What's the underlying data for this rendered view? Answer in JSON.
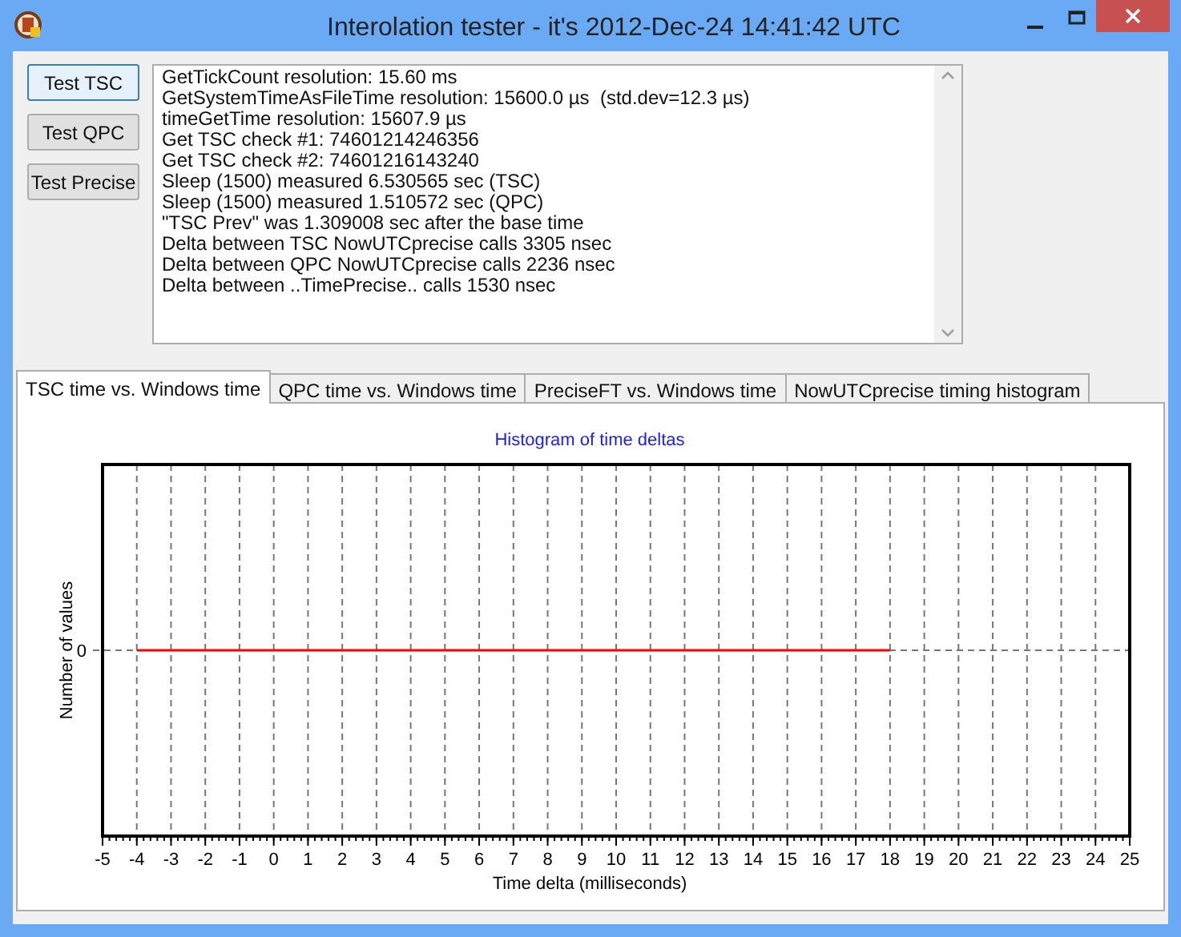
{
  "window": {
    "title": "Interolation tester - it's 2012-Dec-24 14:41:42 UTC"
  },
  "buttons": [
    {
      "label": "Test TSC",
      "selected": true
    },
    {
      "label": "Test QPC",
      "selected": false
    },
    {
      "label": "Test Precise",
      "selected": false
    }
  ],
  "log_lines": [
    "GetTickCount resolution: 15.60 ms",
    "GetSystemTimeAsFileTime resolution: 15600.0 µs  (std.dev=12.3 µs)",
    "timeGetTime resolution: 15607.9 µs",
    "Get TSC check #1: 74601214246356",
    "Get TSC check #2: 74601216143240",
    "Sleep (1500) measured 6.530565 sec (TSC)",
    "Sleep (1500) measured 1.510572 sec (QPC)",
    "\"TSC Prev\" was 1.309008 sec after the base time",
    "Delta between TSC NowUTCprecise calls 3305 nsec",
    "Delta between QPC NowUTCprecise calls 2236 nsec",
    "Delta between ..TimePrecise.. calls 1530 nsec"
  ],
  "tabs": [
    {
      "label": "TSC time vs. Windows time",
      "selected": true
    },
    {
      "label": "QPC time vs. Windows time",
      "selected": false
    },
    {
      "label": "PreciseFT vs. Windows time",
      "selected": false
    },
    {
      "label": "NowUTCprecise timing histogram",
      "selected": false
    }
  ],
  "chart": {
    "title": "Histogram of time deltas",
    "x_axis_title": "Time delta (milliseconds)",
    "y_axis_title": "Number of values",
    "x_tick_labels": [
      "-5",
      "-4",
      "-3",
      "-2",
      "-1",
      "0",
      "1",
      "2",
      "3",
      "4",
      "5",
      "6",
      "7",
      "8",
      "9",
      "10",
      "11",
      "12",
      "13",
      "14",
      "15",
      "16",
      "17",
      "18",
      "19",
      "20",
      "21",
      "22",
      "23",
      "24",
      "25"
    ],
    "y_tick_labels": [
      "0"
    ]
  }
}
